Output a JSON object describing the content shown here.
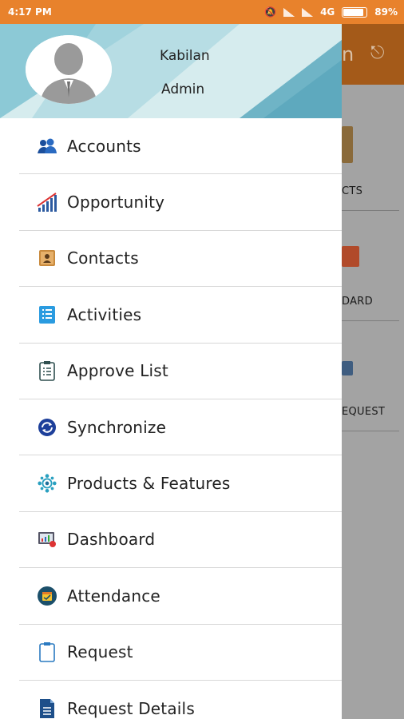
{
  "status_bar": {
    "time": "4:17 PM",
    "network": "4G",
    "battery": "89%",
    "battery_level": 0.89
  },
  "background_app": {
    "tiles": [
      {
        "label": "CTS"
      },
      {
        "label": "DARD"
      },
      {
        "label": "EQUEST"
      }
    ]
  },
  "drawer": {
    "user_name": "Kabilan",
    "user_role": "Admin",
    "items": [
      {
        "label": "Accounts",
        "icon": "accounts-icon"
      },
      {
        "label": "Opportunity",
        "icon": "opportunity-chart-icon"
      },
      {
        "label": "Contacts",
        "icon": "contacts-book-icon"
      },
      {
        "label": "Activities",
        "icon": "activities-list-icon"
      },
      {
        "label": "Approve List",
        "icon": "clipboard-list-icon"
      },
      {
        "label": "Synchronize",
        "icon": "sync-icon"
      },
      {
        "label": "Products & Features",
        "icon": "products-gear-icon"
      },
      {
        "label": "Dashboard",
        "icon": "dashboard-icon"
      },
      {
        "label": "Attendance",
        "icon": "attendance-icon"
      },
      {
        "label": "Request",
        "icon": "request-clipboard-icon"
      },
      {
        "label": "Request Details",
        "icon": "request-details-icon"
      }
    ]
  },
  "colors": {
    "status_bar": "#e8822c",
    "header_teal": "#7ec3d2",
    "header_light": "#cde6ea"
  }
}
